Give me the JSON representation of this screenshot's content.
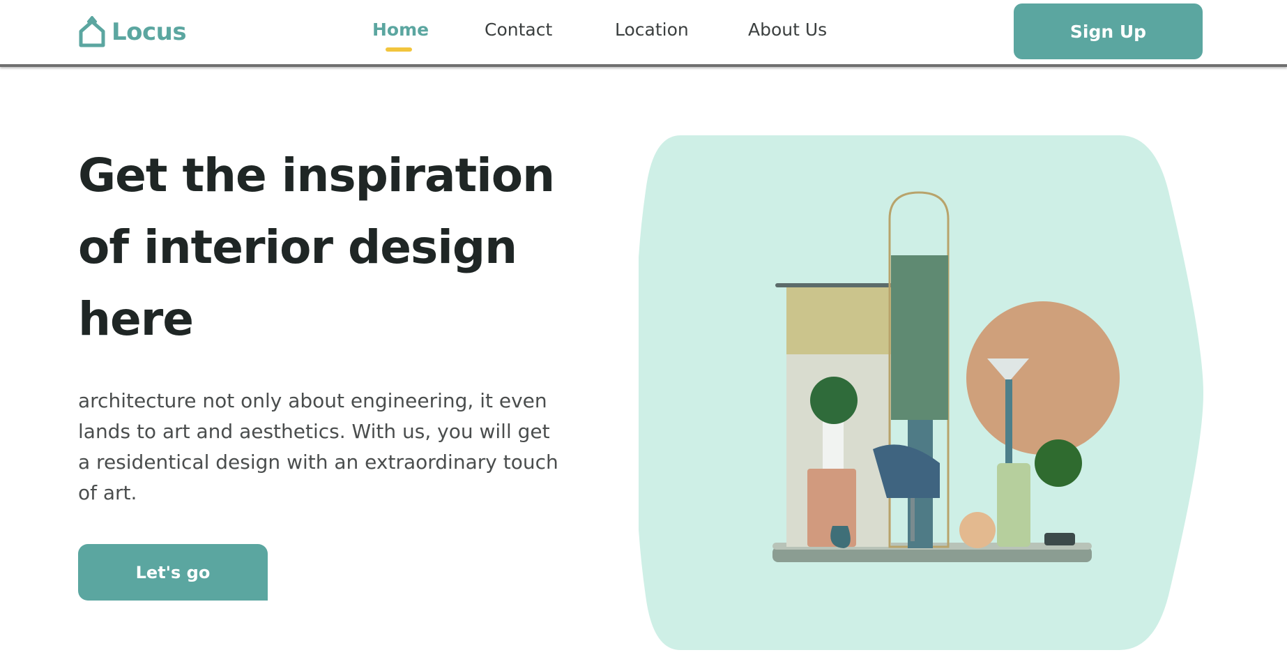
{
  "brand": {
    "name": "Locus",
    "logo_icon": "house-icon",
    "color": "#5ba6a0"
  },
  "nav": {
    "items": [
      {
        "label": "Home",
        "active": true
      },
      {
        "label": "Contact",
        "active": false
      },
      {
        "label": "Location",
        "active": false
      },
      {
        "label": "About Us",
        "active": false
      }
    ],
    "active_indicator_color": "#f2c53d"
  },
  "header": {
    "signup_label": "Sign Up"
  },
  "hero": {
    "title_lines": [
      "Get the inspiration",
      "of interior design",
      "here"
    ],
    "description_lines": [
      "architecture not only about engineering, it even",
      "lands to art and aesthetics. With us, you will get",
      "a residentical design with an extraordinary touch",
      "of art."
    ],
    "cta_label": "Let's go",
    "image_background": "#ceefe6"
  },
  "colors": {
    "accent": "#5ba6a0",
    "text": "#1f2625",
    "muted_text": "#4a4d4d",
    "highlight": "#f2c53d"
  }
}
